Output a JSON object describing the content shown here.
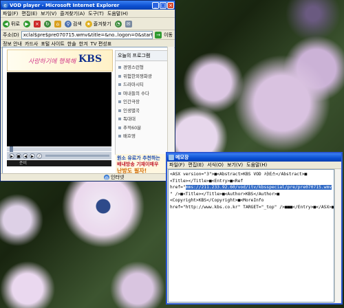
{
  "ie_window": {
    "title": "VOD player - Microsoft Internet Explorer",
    "menu": [
      "파일(F)",
      "편집(E)",
      "보기(V)",
      "즐겨찾기(A)",
      "도구(T)",
      "도움말(H)"
    ],
    "toolbar": {
      "back": "뒤로",
      "search": "검색",
      "favorites": "즐겨찾기"
    },
    "address_label": "주소(D)",
    "address_value": "xclal$pre$pre070715.wmv&title=&no..logon=0&startime=&endtime=",
    "go_label": "이동",
    "links": [
      "정보 안내",
      "카드사",
      "포털 사이트",
      "한솔",
      "한겨",
      "TV 편성표"
    ],
    "banner": {
      "slogan": "사랑하기에 행복해",
      "brand": "KBS"
    },
    "program_panel": {
      "header": "오늘의 프로그램",
      "header_accent": "프로그램",
      "items": [
        "경영스런형",
        "위험한외쟁화광",
        "드라마시티",
        "며내들의 수다",
        "인간극장",
        "인생별곡",
        "독대대",
        "추적60분",
        "배호영"
      ]
    },
    "player_status": "준비",
    "ad": {
      "line1": "원소 유료가 추천하는",
      "line2": "배내방송 기재이매우",
      "line3": "난방도 필자!"
    },
    "status_zone": "인터넷",
    "colors": {
      "title_bar": "#0b4fd1",
      "kbs_blue": "#12318e",
      "slogan_pink": "#d23a8a"
    }
  },
  "notepad": {
    "title": "메모장",
    "menu": [
      "파일(F)",
      "편집(E)",
      "서식(O)",
      "보기(V)",
      "도움말(H)"
    ],
    "lines": {
      "l1": "<ASX version=\"3\">■<Abstract>KBS VOD 서비스</Abstract>■",
      "l2": "<Title></Title>■<Entry>■<Ref",
      "l3a": "href=\"",
      "l3sel": "mms://211.233.92.60/vod/itv/kbsspecial/pre/pre070715.wmv",
      "l4": "\" />■<Title></Title>■<Author>KBS</Author>■",
      "l5": "<Copyright>KBS</Copyright>■<MoreInfo",
      "l6": "href=\"http://www.kbs.co.kr\" TARGET=\"_top\" />■■■</Entry>■</ASX>■"
    }
  }
}
